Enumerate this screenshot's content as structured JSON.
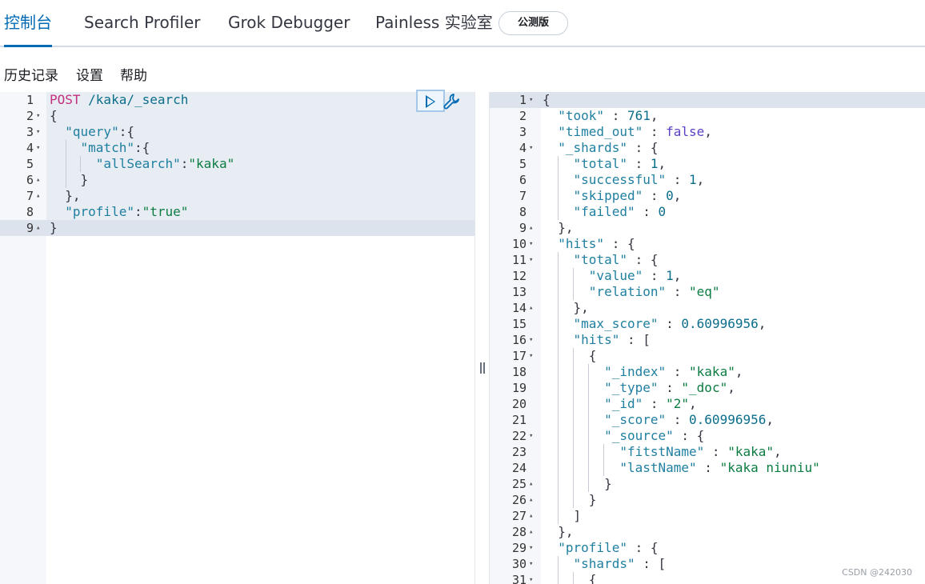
{
  "tabs": [
    {
      "label": "控制台",
      "active": true
    },
    {
      "label": "Search Profiler"
    },
    {
      "label": "Grok Debugger"
    },
    {
      "label": "Painless 实验室"
    }
  ],
  "beta_badge": "公测版",
  "menu": [
    "历史记录",
    "设置",
    "帮助"
  ],
  "request_lines": [
    [
      {
        "t": "POST",
        "c": "m"
      },
      {
        "t": " /kaka/_search",
        "c": "n"
      }
    ],
    [
      {
        "t": "{",
        "c": "p"
      }
    ],
    [
      {
        "t": "  ",
        "c": "p"
      },
      {
        "t": "\"query\"",
        "c": "k"
      },
      {
        "t": ":{",
        "c": "p"
      }
    ],
    [
      {
        "t": "    ",
        "c": "p"
      },
      {
        "t": "\"match\"",
        "c": "k"
      },
      {
        "t": ":{",
        "c": "p"
      }
    ],
    [
      {
        "t": "      ",
        "c": "p"
      },
      {
        "t": "\"allSearch\"",
        "c": "k"
      },
      {
        "t": ":",
        "c": "p"
      },
      {
        "t": "\"kaka\"",
        "c": "s"
      }
    ],
    [
      {
        "t": "    }",
        "c": "p"
      }
    ],
    [
      {
        "t": "  },",
        "c": "p"
      }
    ],
    [
      {
        "t": "  ",
        "c": "p"
      },
      {
        "t": "\"profile\"",
        "c": "k"
      },
      {
        "t": ":",
        "c": "p"
      },
      {
        "t": "\"true\"",
        "c": "s"
      }
    ],
    [
      {
        "t": "}",
        "c": "p"
      }
    ]
  ],
  "request_folds": [
    "",
    "▾",
    "▾",
    "▾",
    "",
    "▴",
    "▴",
    "",
    "▴"
  ],
  "response_lines": [
    [
      {
        "t": "{",
        "c": "p"
      }
    ],
    [
      {
        "t": "  ",
        "c": "p"
      },
      {
        "t": "\"took\"",
        "c": "k"
      },
      {
        "t": " : ",
        "c": "p"
      },
      {
        "t": "761",
        "c": "n"
      },
      {
        "t": ",",
        "c": "p"
      }
    ],
    [
      {
        "t": "  ",
        "c": "p"
      },
      {
        "t": "\"timed_out\"",
        "c": "k"
      },
      {
        "t": " : ",
        "c": "p"
      },
      {
        "t": "false",
        "c": "b"
      },
      {
        "t": ",",
        "c": "p"
      }
    ],
    [
      {
        "t": "  ",
        "c": "p"
      },
      {
        "t": "\"_shards\"",
        "c": "k"
      },
      {
        "t": " : {",
        "c": "p"
      }
    ],
    [
      {
        "t": "    ",
        "c": "p"
      },
      {
        "t": "\"total\"",
        "c": "k"
      },
      {
        "t": " : ",
        "c": "p"
      },
      {
        "t": "1",
        "c": "n"
      },
      {
        "t": ",",
        "c": "p"
      }
    ],
    [
      {
        "t": "    ",
        "c": "p"
      },
      {
        "t": "\"successful\"",
        "c": "k"
      },
      {
        "t": " : ",
        "c": "p"
      },
      {
        "t": "1",
        "c": "n"
      },
      {
        "t": ",",
        "c": "p"
      }
    ],
    [
      {
        "t": "    ",
        "c": "p"
      },
      {
        "t": "\"skipped\"",
        "c": "k"
      },
      {
        "t": " : ",
        "c": "p"
      },
      {
        "t": "0",
        "c": "n"
      },
      {
        "t": ",",
        "c": "p"
      }
    ],
    [
      {
        "t": "    ",
        "c": "p"
      },
      {
        "t": "\"failed\"",
        "c": "k"
      },
      {
        "t": " : ",
        "c": "p"
      },
      {
        "t": "0",
        "c": "n"
      }
    ],
    [
      {
        "t": "  },",
        "c": "p"
      }
    ],
    [
      {
        "t": "  ",
        "c": "p"
      },
      {
        "t": "\"hits\"",
        "c": "k"
      },
      {
        "t": " : {",
        "c": "p"
      }
    ],
    [
      {
        "t": "    ",
        "c": "p"
      },
      {
        "t": "\"total\"",
        "c": "k"
      },
      {
        "t": " : {",
        "c": "p"
      }
    ],
    [
      {
        "t": "      ",
        "c": "p"
      },
      {
        "t": "\"value\"",
        "c": "k"
      },
      {
        "t": " : ",
        "c": "p"
      },
      {
        "t": "1",
        "c": "n"
      },
      {
        "t": ",",
        "c": "p"
      }
    ],
    [
      {
        "t": "      ",
        "c": "p"
      },
      {
        "t": "\"relation\"",
        "c": "k"
      },
      {
        "t": " : ",
        "c": "p"
      },
      {
        "t": "\"eq\"",
        "c": "s"
      }
    ],
    [
      {
        "t": "    },",
        "c": "p"
      }
    ],
    [
      {
        "t": "    ",
        "c": "p"
      },
      {
        "t": "\"max_score\"",
        "c": "k"
      },
      {
        "t": " : ",
        "c": "p"
      },
      {
        "t": "0.60996956",
        "c": "n"
      },
      {
        "t": ",",
        "c": "p"
      }
    ],
    [
      {
        "t": "    ",
        "c": "p"
      },
      {
        "t": "\"hits\"",
        "c": "k"
      },
      {
        "t": " : [",
        "c": "p"
      }
    ],
    [
      {
        "t": "      {",
        "c": "p"
      }
    ],
    [
      {
        "t": "        ",
        "c": "p"
      },
      {
        "t": "\"_index\"",
        "c": "k"
      },
      {
        "t": " : ",
        "c": "p"
      },
      {
        "t": "\"kaka\"",
        "c": "s"
      },
      {
        "t": ",",
        "c": "p"
      }
    ],
    [
      {
        "t": "        ",
        "c": "p"
      },
      {
        "t": "\"_type\"",
        "c": "k"
      },
      {
        "t": " : ",
        "c": "p"
      },
      {
        "t": "\"_doc\"",
        "c": "s"
      },
      {
        "t": ",",
        "c": "p"
      }
    ],
    [
      {
        "t": "        ",
        "c": "p"
      },
      {
        "t": "\"_id\"",
        "c": "k"
      },
      {
        "t": " : ",
        "c": "p"
      },
      {
        "t": "\"2\"",
        "c": "s"
      },
      {
        "t": ",",
        "c": "p"
      }
    ],
    [
      {
        "t": "        ",
        "c": "p"
      },
      {
        "t": "\"_score\"",
        "c": "k"
      },
      {
        "t": " : ",
        "c": "p"
      },
      {
        "t": "0.60996956",
        "c": "n"
      },
      {
        "t": ",",
        "c": "p"
      }
    ],
    [
      {
        "t": "        ",
        "c": "p"
      },
      {
        "t": "\"_source\"",
        "c": "k"
      },
      {
        "t": " : {",
        "c": "p"
      }
    ],
    [
      {
        "t": "          ",
        "c": "p"
      },
      {
        "t": "\"fitstName\"",
        "c": "k"
      },
      {
        "t": " : ",
        "c": "p"
      },
      {
        "t": "\"kaka\"",
        "c": "s"
      },
      {
        "t": ",",
        "c": "p"
      }
    ],
    [
      {
        "t": "          ",
        "c": "p"
      },
      {
        "t": "\"lastName\"",
        "c": "k"
      },
      {
        "t": " : ",
        "c": "p"
      },
      {
        "t": "\"kaka niuniu\"",
        "c": "s"
      }
    ],
    [
      {
        "t": "        }",
        "c": "p"
      }
    ],
    [
      {
        "t": "      }",
        "c": "p"
      }
    ],
    [
      {
        "t": "    ]",
        "c": "p"
      }
    ],
    [
      {
        "t": "  },",
        "c": "p"
      }
    ],
    [
      {
        "t": "  ",
        "c": "p"
      },
      {
        "t": "\"profile\"",
        "c": "k"
      },
      {
        "t": " : {",
        "c": "p"
      }
    ],
    [
      {
        "t": "    ",
        "c": "p"
      },
      {
        "t": "\"shards\"",
        "c": "k"
      },
      {
        "t": " : [",
        "c": "p"
      }
    ],
    [
      {
        "t": "      {",
        "c": "p"
      }
    ]
  ],
  "response_folds": [
    "▾",
    "",
    "",
    "▾",
    "",
    "",
    "",
    "",
    "▴",
    "▾",
    "▾",
    "",
    "",
    "▴",
    "",
    "▾",
    "▾",
    "",
    "",
    "",
    "",
    "▾",
    "",
    "",
    "▴",
    "▴",
    "▴",
    "▴",
    "▾",
    "▾",
    "▾"
  ],
  "watermark": "CSDN @242030",
  "colors": {
    "accent": "#006bb4",
    "key": "#1f7fa0",
    "string": "#0c7d42",
    "method": "#c3307e",
    "boolean": "#5b3fc4"
  }
}
